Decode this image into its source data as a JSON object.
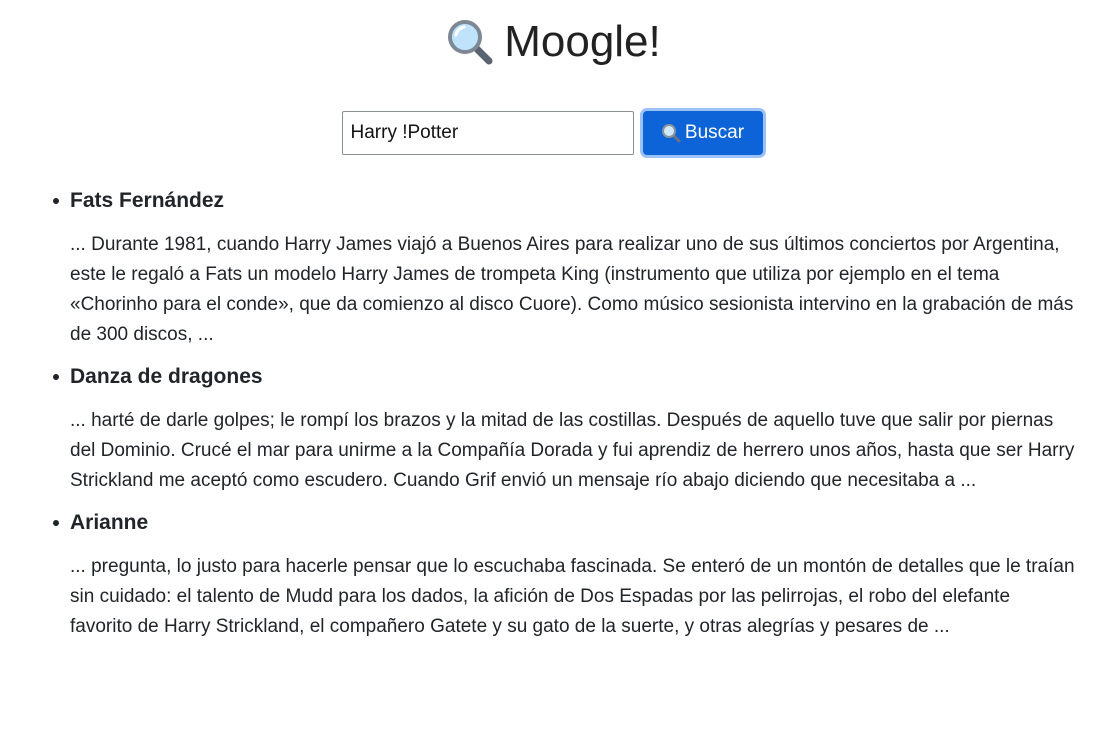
{
  "header": {
    "title": "Moogle!",
    "icon": "magnifying-glass-icon"
  },
  "search": {
    "value": "Harry !Potter",
    "button_label": "Buscar",
    "button_icon": "magnifying-glass-icon"
  },
  "colors": {
    "button_bg": "#0d64d8",
    "button_focus_ring": "#9cc1f6",
    "text": "#212529"
  },
  "results": [
    {
      "title": "Fats Fernández",
      "snippet": "... Durante 1981, cuando Harry James viajó a Buenos Aires para realizar uno de sus últimos conciertos por Argentina, este le regaló a Fats un modelo Harry James de trompeta King (instrumento que utiliza por ejemplo en el tema «Chorinho para el conde», que da comienzo al disco Cuore).  Como músico sesionista intervino en la grabación de más de 300 discos, ..."
    },
    {
      "title": "Danza de dragones",
      "snippet": "... harté de darle golpes; le rompí los brazos y la mitad de las costillas. Después de aquello tuve que salir por piernas del Dominio. Crucé el mar para unirme a la Compañía Dorada y fui aprendiz de herrero unos años, hasta que ser Harry Strickland me aceptó como escudero. Cuando Grif envió un mensaje río abajo diciendo que necesitaba a ..."
    },
    {
      "title": "Arianne",
      "snippet": "... pregunta, lo justo para hacerle pensar que lo escuchaba fascinada. Se enteró de un montón de detalles que le traían sin cuidado: el talento de Mudd para los dados, la afición de Dos Espadas por las pelirrojas, el robo del elefante favorito de Harry Strickland, el compañero Gatete y su gato de la suerte, y otras alegrías y pesares de ..."
    }
  ]
}
